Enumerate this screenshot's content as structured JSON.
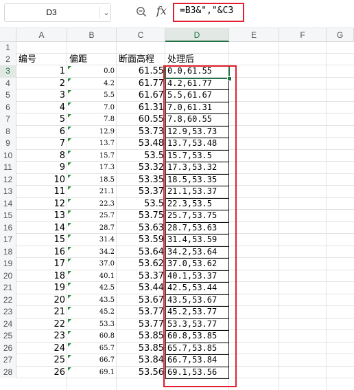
{
  "formula_bar": {
    "name_box": "D3",
    "formula": "=B3&\",\"&C3"
  },
  "columns": [
    "A",
    "B",
    "C",
    "D",
    "E",
    "F",
    "G"
  ],
  "headers": {
    "a": "编号",
    "b": "偏距",
    "c": "断面高程",
    "d": "处理后"
  },
  "rows": [
    {
      "n": "1",
      "a": "",
      "b": "",
      "c": "",
      "d": ""
    },
    {
      "n": "2",
      "a": "",
      "b": "",
      "c": "",
      "d": ""
    },
    {
      "n": "3",
      "a": "1",
      "b": "0.0",
      "c": "61.55",
      "d": "0.0,61.55"
    },
    {
      "n": "4",
      "a": "2",
      "b": "4.2",
      "c": "61.77",
      "d": "4.2,61.77"
    },
    {
      "n": "5",
      "a": "3",
      "b": "5.5",
      "c": "61.67",
      "d": "5.5,61.67"
    },
    {
      "n": "6",
      "a": "4",
      "b": "7.0",
      "c": "61.31",
      "d": "7.0,61.31"
    },
    {
      "n": "7",
      "a": "5",
      "b": "7.8",
      "c": "60.55",
      "d": "7.8,60.55"
    },
    {
      "n": "8",
      "a": "6",
      "b": "12.9",
      "c": "53.73",
      "d": "12.9,53.73"
    },
    {
      "n": "9",
      "a": "7",
      "b": "13.7",
      "c": "53.48",
      "d": "13.7,53.48"
    },
    {
      "n": "10",
      "a": "8",
      "b": "15.7",
      "c": "53.5",
      "d": "15.7,53.5"
    },
    {
      "n": "11",
      "a": "9",
      "b": "17.3",
      "c": "53.32",
      "d": "17.3,53.32"
    },
    {
      "n": "12",
      "a": "10",
      "b": "18.5",
      "c": "53.35",
      "d": "18.5,53.35"
    },
    {
      "n": "13",
      "a": "11",
      "b": "21.1",
      "c": "53.37",
      "d": "21.1,53.37"
    },
    {
      "n": "14",
      "a": "12",
      "b": "22.3",
      "c": "53.5",
      "d": "22.3,53.5"
    },
    {
      "n": "15",
      "a": "13",
      "b": "25.7",
      "c": "53.75",
      "d": "25.7,53.75"
    },
    {
      "n": "16",
      "a": "14",
      "b": "28.7",
      "c": "53.63",
      "d": "28.7,53.63"
    },
    {
      "n": "17",
      "a": "15",
      "b": "31.4",
      "c": "53.59",
      "d": "31.4,53.59"
    },
    {
      "n": "18",
      "a": "16",
      "b": "34.2",
      "c": "53.64",
      "d": "34.2,53.64"
    },
    {
      "n": "19",
      "a": "17",
      "b": "37.0",
      "c": "53.62",
      "d": "37.0,53.62"
    },
    {
      "n": "20",
      "a": "18",
      "b": "40.1",
      "c": "53.37",
      "d": "40.1,53.37"
    },
    {
      "n": "21",
      "a": "19",
      "b": "42.5",
      "c": "53.44",
      "d": "42.5,53.44"
    },
    {
      "n": "22",
      "a": "20",
      "b": "43.5",
      "c": "53.67",
      "d": "43.5,53.67"
    },
    {
      "n": "23",
      "a": "21",
      "b": "45.2",
      "c": "53.77",
      "d": "45.2,53.77"
    },
    {
      "n": "24",
      "a": "22",
      "b": "53.3",
      "c": "53.77",
      "d": "53.3,53.77"
    },
    {
      "n": "25",
      "a": "23",
      "b": "60.8",
      "c": "53.85",
      "d": "60.8,53.85"
    },
    {
      "n": "26",
      "a": "24",
      "b": "65.7",
      "c": "53.85",
      "d": "65.7,53.85"
    },
    {
      "n": "27",
      "a": "25",
      "b": "66.7",
      "c": "53.84",
      "d": "66.7,53.84"
    },
    {
      "n": "28",
      "a": "26",
      "b": "69.1",
      "c": "53.56",
      "d": "69.1,53.56"
    }
  ],
  "colors": {
    "highlight": "#e0202e",
    "selection": "#217346"
  }
}
